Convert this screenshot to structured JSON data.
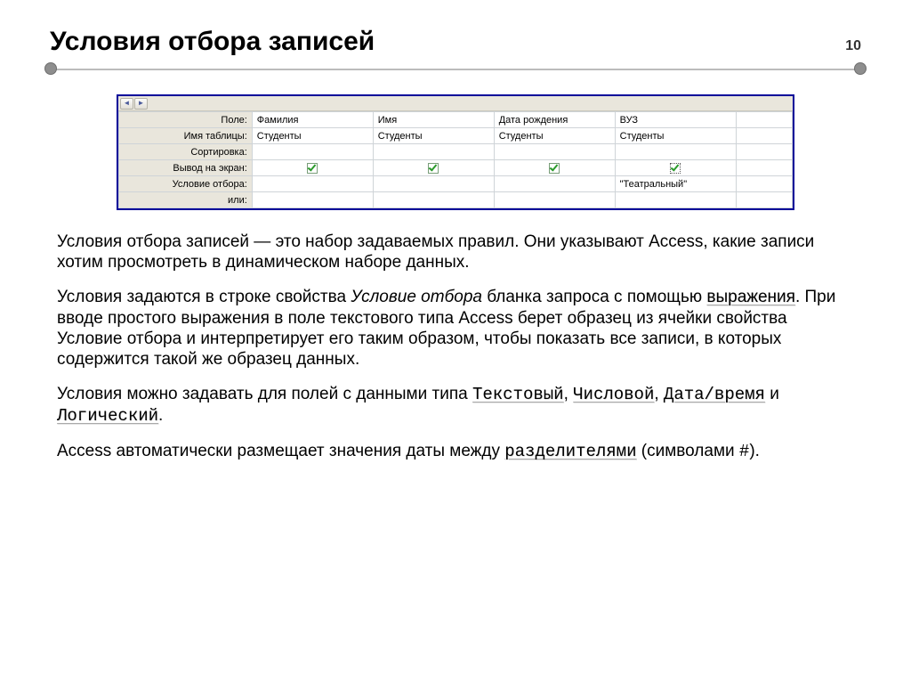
{
  "header": {
    "title": "Условия отбора записей",
    "page_number": "10"
  },
  "query_grid": {
    "row_labels": {
      "field": "Поле:",
      "table": "Имя таблицы:",
      "sort": "Сортировка:",
      "show": "Вывод на экран:",
      "criteria": "Условие отбора:",
      "or": "или:"
    },
    "columns": [
      {
        "field": "Фамилия",
        "table": "Студенты",
        "show": true,
        "criteria": ""
      },
      {
        "field": "Имя",
        "table": "Студенты",
        "show": true,
        "criteria": ""
      },
      {
        "field": "Дата рождения",
        "table": "Студенты",
        "show": true,
        "criteria": ""
      },
      {
        "field": "ВУЗ",
        "table": "Студенты",
        "show": true,
        "show_dotted": true,
        "criteria": "\"Театральный\""
      }
    ]
  },
  "paragraphs": {
    "p1_a": "Условия отбора записей — это набор задаваемых правил. Они указывают Access, какие записи хотим просмотреть в динамическом наборе данных.",
    "p2_a": "Условия задаются в строке свойства ",
    "p2_italic": "Условие отбора",
    "p2_b": " бланка запроса с помощью ",
    "p2_under1": "выражения",
    "p2_c": ". При  вводе простого выражения в поле текстового типа Access берет образец из ячейки свойства Условие отбора и интерпретирует его таким образом, чтобы показать все записи, в которых содержится такой же образец данных.",
    "p3_a": "Условия можно задавать для полей с данными типа ",
    "p3_m1": "Текстовый",
    "p3_s1": ", ",
    "p3_m2": "Числовой",
    "p3_s2": ", ",
    "p3_m3": "Дата/время",
    "p3_s3": " и ",
    "p3_m4": "Логический",
    "p3_s4": ".",
    "p4_a": "Access автоматически размещает значения даты между ",
    "p4_m1": "разделителями",
    "p4_b": " (символами ",
    "p4_m2": "#",
    "p4_c": ")."
  }
}
